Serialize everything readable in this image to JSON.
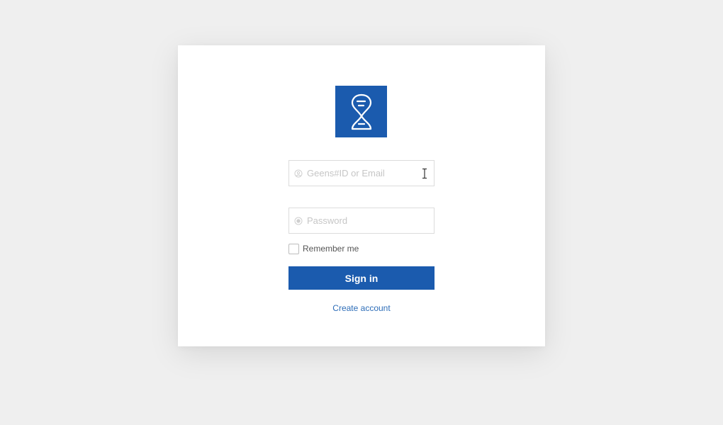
{
  "login": {
    "logo_icon": "hourglass-dna-logo-icon",
    "id_field": {
      "placeholder": "Geens#ID or Email",
      "value": "",
      "icon": "circle-user-icon"
    },
    "password_field": {
      "placeholder": "Password",
      "value": "",
      "icon": "lock-circle-icon"
    },
    "remember_me": {
      "label": "Remember me",
      "checked": false
    },
    "sign_in_label": "Sign in",
    "create_account_label": "Create account"
  },
  "colors": {
    "page_background": "#efefef",
    "card_background": "#ffffff",
    "brand_blue": "#1b5bae",
    "link_blue": "#2d6db8",
    "input_border": "#dcdcdc",
    "placeholder": "#c6c6c6"
  }
}
